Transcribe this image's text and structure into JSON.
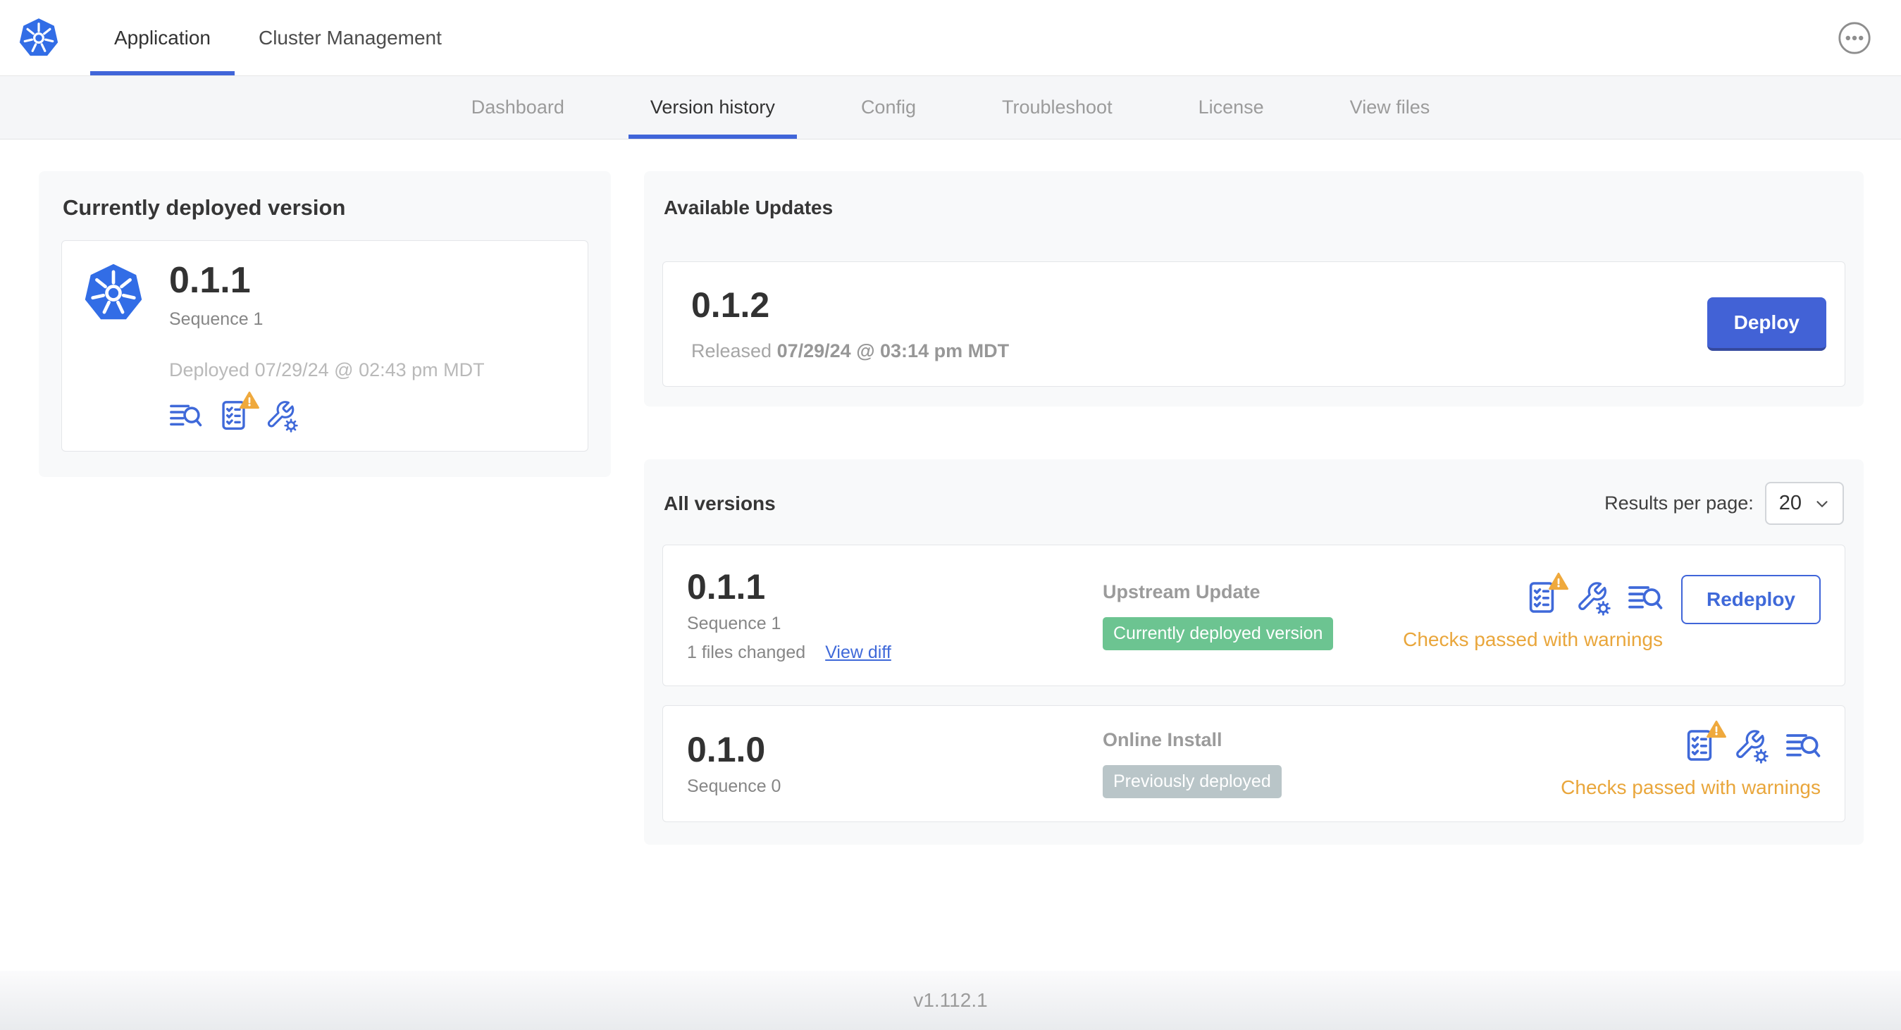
{
  "colors": {
    "brand_blue": "#326de6",
    "ui_blue": "#3f69d9",
    "button_blue": "#4262d6",
    "accent_underline": "#4065d9",
    "warning_amber": "#e9a63b",
    "badge_green": "#6cc491",
    "badge_gray": "#b9c5c8"
  },
  "header": {
    "logo_icon": "kubernetes-logo",
    "tabs": [
      {
        "label": "Application",
        "active": true
      },
      {
        "label": "Cluster Management",
        "active": false
      }
    ],
    "overflow_menu_icon": "ellipsis-icon"
  },
  "subnav": {
    "tabs": [
      {
        "label": "Dashboard",
        "active": false
      },
      {
        "label": "Version history",
        "active": true
      },
      {
        "label": "Config",
        "active": false
      },
      {
        "label": "Troubleshoot",
        "active": false
      },
      {
        "label": "License",
        "active": false
      },
      {
        "label": "View files",
        "active": false
      }
    ]
  },
  "current_version": {
    "title": "Currently deployed version",
    "version": "0.1.1",
    "sequence": "Sequence 1",
    "deployed_text": "Deployed 07/29/24 @ 02:43 pm MDT",
    "icons": [
      "logs-icon",
      "preflight-checks-warning-icon",
      "config-icon"
    ]
  },
  "available_updates": {
    "title": "Available Updates",
    "version": "0.1.2",
    "released_prefix": "Released",
    "released_at": "07/29/24 @ 03:14 pm MDT",
    "deploy_label": "Deploy"
  },
  "all_versions": {
    "title": "All versions",
    "results_per_page_label": "Results per page:",
    "results_per_page_value": "20",
    "rows": [
      {
        "version": "0.1.1",
        "sequence": "Sequence 1",
        "files_changed": "1 files changed",
        "view_diff_label": "View diff",
        "source": "Upstream Update",
        "badge": "Currently deployed version",
        "badge_type": "green",
        "icons": [
          "preflight-checks-warning-icon",
          "config-icon",
          "logs-icon"
        ],
        "checks_text": "Checks passed with warnings",
        "action_label": "Redeploy"
      },
      {
        "version": "0.1.0",
        "sequence": "Sequence 0",
        "source": "Online Install",
        "badge": "Previously deployed",
        "badge_type": "gray",
        "icons": [
          "preflight-checks-warning-icon",
          "config-icon",
          "logs-icon"
        ],
        "checks_text": "Checks passed with warnings"
      }
    ]
  },
  "footer": {
    "app_version": "v1.112.1"
  }
}
